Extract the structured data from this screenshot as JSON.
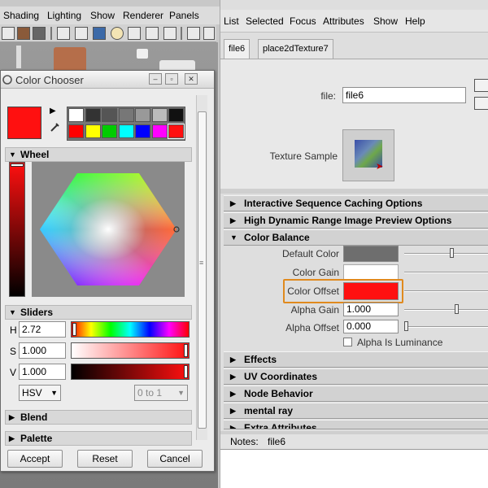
{
  "maya_menu": [
    "Shading",
    "Lighting",
    "Show",
    "Renderer",
    "Panels"
  ],
  "color_chooser": {
    "title": "Color Chooser",
    "current_color": "#ff1010",
    "swatches_row1": [
      "#ffffff",
      "#333333",
      "#555555",
      "#777777",
      "#999999",
      "#bbbbbb",
      "#111111"
    ],
    "swatches_row2": [
      "#ff0000",
      "#ffff00",
      "#00cc00",
      "#00ffff",
      "#0000ff",
      "#ff00ff",
      "#ff1010"
    ],
    "wheel_label": "Wheel",
    "sliders_label": "Sliders",
    "h_label": "H",
    "h_value": "2.72",
    "s_label": "S",
    "s_value": "1.000",
    "v_label": "V",
    "v_value": "1.000",
    "mode": "HSV",
    "range": "0 to 1",
    "blend_label": "Blend",
    "palette_label": "Palette",
    "accept": "Accept",
    "reset": "Reset",
    "cancel": "Cancel"
  },
  "attribute_editor": {
    "menu": [
      "List",
      "Selected",
      "Focus",
      "Attributes",
      "Show",
      "Help"
    ],
    "tabs": [
      "file6",
      "place2dTexture7"
    ],
    "file_label": "file:",
    "file_value": "file6",
    "texture_sample_label": "Texture Sample",
    "sections_collapsed_top": [
      "Interactive Sequence Caching Options",
      "High Dynamic Range Image Preview Options"
    ],
    "color_balance_label": "Color Balance",
    "default_color_label": "Default Color",
    "default_color": "#6e6e6e",
    "color_gain_label": "Color Gain",
    "color_gain": "#ffffff",
    "color_offset_label": "Color Offset",
    "color_offset": "#ff1010",
    "alpha_gain_label": "Alpha Gain",
    "alpha_gain_value": "1.000",
    "alpha_offset_label": "Alpha Offset",
    "alpha_offset_value": "0.000",
    "alpha_is_luminance_label": "Alpha Is Luminance",
    "sections_collapsed_bottom": [
      "Effects",
      "UV Coordinates",
      "Node Behavior",
      "mental ray",
      "Extra Attributes"
    ],
    "notes_label": "Notes:",
    "notes_value": "file6"
  },
  "highlight_color": "#e08a1e"
}
